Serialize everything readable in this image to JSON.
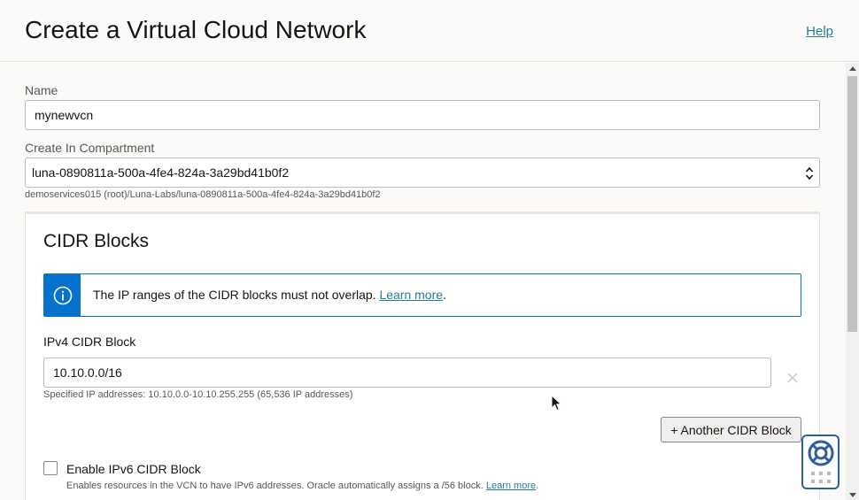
{
  "header": {
    "title": "Create a Virtual Cloud Network",
    "help_label": "Help"
  },
  "form": {
    "name": {
      "label": "Name",
      "value": "mynewvcn"
    },
    "compartment": {
      "label": "Create In Compartment",
      "value": "luna-0890811a-500a-4fe4-824a-3a29bd41b0f2",
      "path": "demoservices015 (root)/Luna-Labs/luna-0890811a-500a-4fe4-824a-3a29bd41b0f2"
    }
  },
  "cidr": {
    "section_title": "CIDR Blocks",
    "info_text": "The IP ranges of the CIDR blocks must not overlap.",
    "info_link": "Learn more",
    "info_suffix": ".",
    "ipv4_label": "IPv4 CIDR Block",
    "ipv4_value": "10.10.0.0/16",
    "ipv4_hint": "Specified IP addresses: 10.10.0.0-10.10.255.255 (65,536 IP addresses)",
    "add_button": "+ Another CIDR Block",
    "ipv6_label": "Enable IPv6 CIDR Block",
    "ipv6_checked": false,
    "ipv6_hint": "Enables resources in the VCN to have IPv6 addresses. Oracle automatically assigns a /56 block.",
    "ipv6_link": "Learn more",
    "ipv6_suffix": "."
  },
  "icons": {
    "info": "info-icon",
    "clear": "close-icon",
    "select_arrows": "chevron-updown-icon",
    "help_widget": "lifebuoy-icon"
  },
  "colors": {
    "accent_blue": "#0572ce",
    "link": "#227e9e",
    "help_widget_border": "#2f5ea8"
  }
}
